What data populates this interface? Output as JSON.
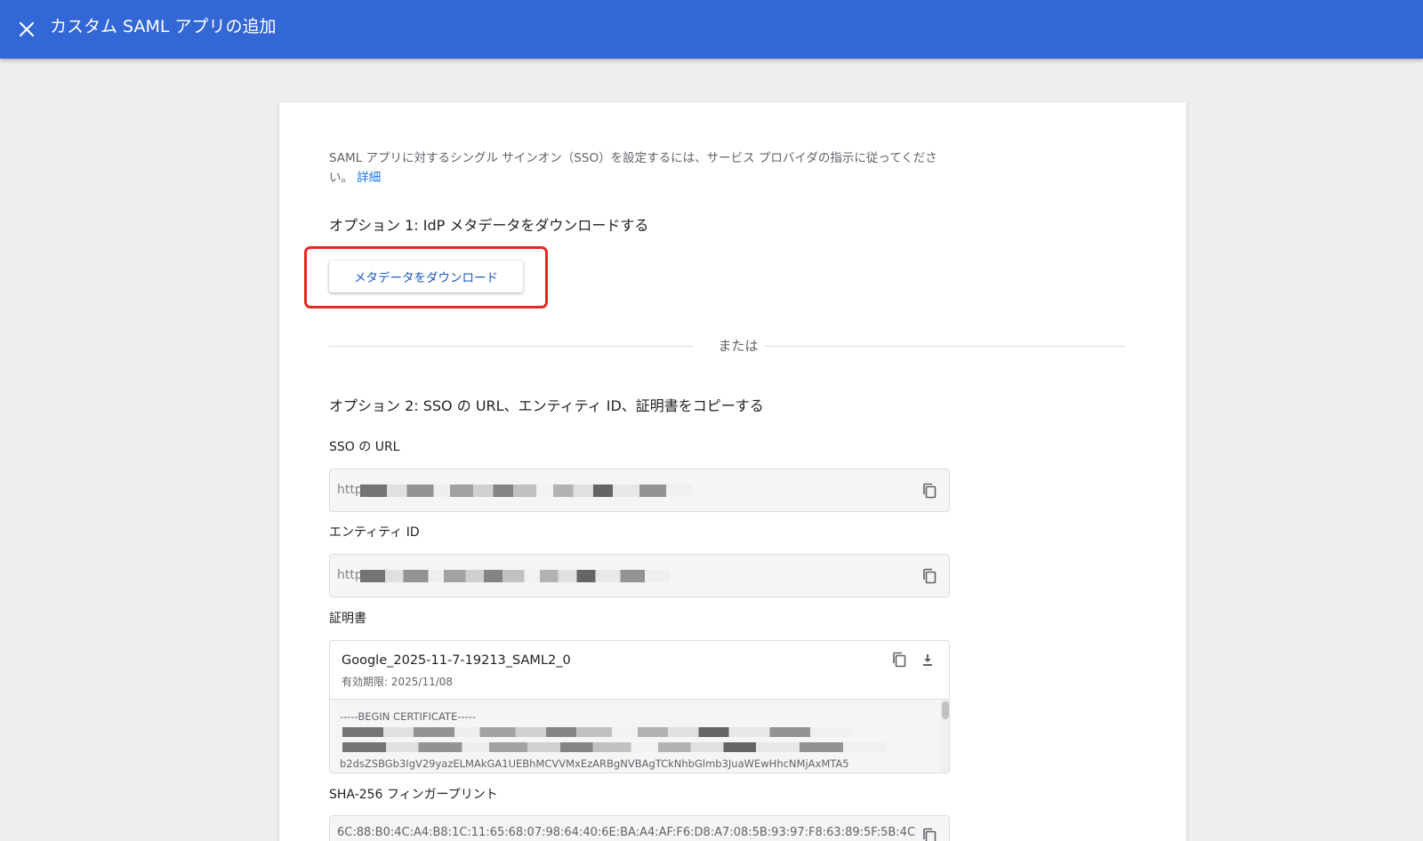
{
  "topbar": {
    "title": "カスタム SAML アプリの追加",
    "background_color": "#3367d6"
  },
  "intro": {
    "text": "SAML アプリに対するシングル サインオン（SSO）を設定するには、サービス プロバイダの指示に従ってください。",
    "link_label": "詳細"
  },
  "option1": {
    "heading": "オプション 1: IdP メタデータをダウンロードする",
    "download_button_label": "メタデータをダウンロード"
  },
  "divider": {
    "label": "または"
  },
  "option2": {
    "heading": "オプション 2: SSO の URL、エンティティ ID、証明書をコピーする",
    "sso_url": {
      "label": "SSO の URL",
      "value_prefix": "http"
    },
    "entity_id": {
      "label": "エンティティ ID",
      "value_prefix": "http"
    },
    "certificate": {
      "label": "証明書",
      "name": "Google_2025-11-7-19213_SAML2_0",
      "expiry": "有効期限: 2025/11/08",
      "begin_line": "-----BEGIN CERTIFICATE-----",
      "visible_line": "b2dsZSBGb3IgV29yazELMAkGA1UEBhMCVVMxEzARBgNVBAgTCkNhbGlmb3JuaWEwHhcNMjAxMTA5"
    },
    "sha256": {
      "label": "SHA-256 フィンガープリント",
      "value": "6C:88:B0:4C:A4:B8:1C:11:65:68:07:98:64:40:6E:BA:A4:AF:F6:D8:A7:08:5B:93:97:F8:63:89:5F:5B:4C:"
    }
  },
  "colors": {
    "highlight_border": "#e8261c",
    "link": "#1a73e8"
  }
}
